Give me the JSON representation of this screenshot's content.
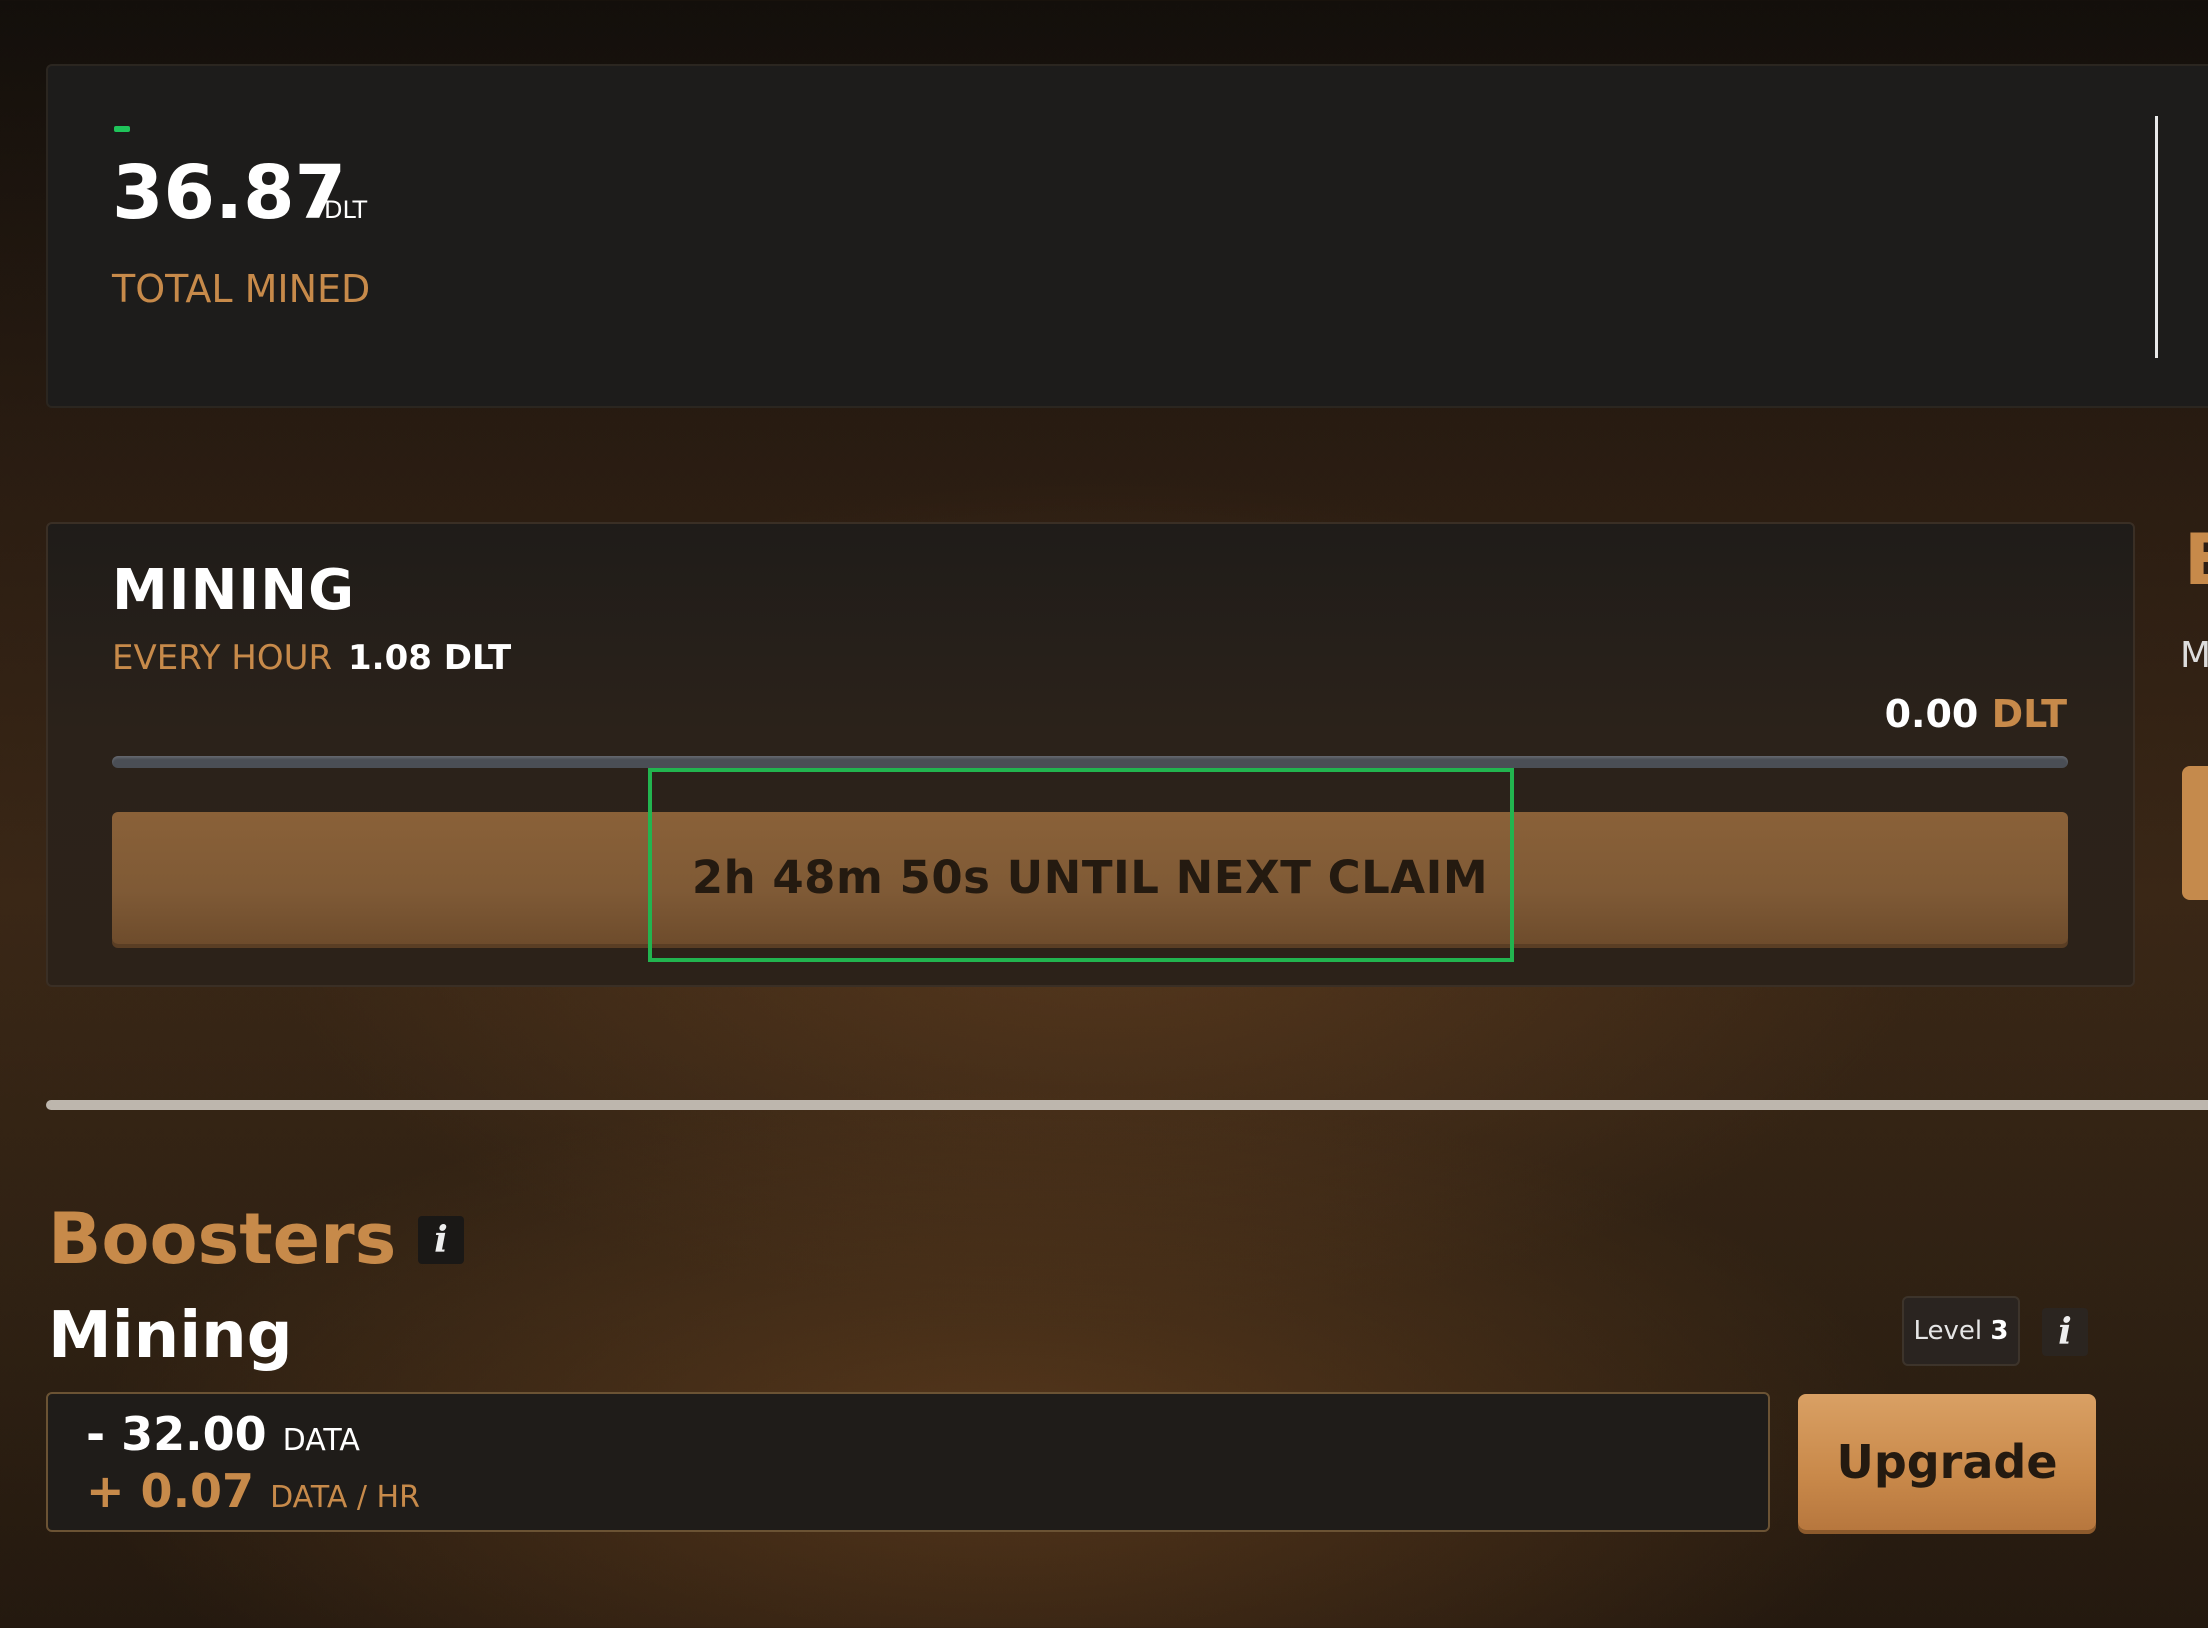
{
  "total": {
    "value": "36.87",
    "unit": "DLT",
    "label": "TOTAL MINED"
  },
  "mining": {
    "title": "MINING",
    "rate_label": "EVERY HOUR",
    "rate_value": "1.08 DLT",
    "progress_amount": "0.00",
    "progress_unit": "DLT",
    "progress_fraction": 0,
    "claim_label": "2h 48m 50s UNTIL NEXT CLAIM"
  },
  "right_edge": {
    "letter_top": "E",
    "letter_sub": "M"
  },
  "boosters": {
    "title": "Boosters",
    "info_icon": "i",
    "mining": {
      "title": "Mining",
      "level_label": "Level",
      "level_value": "3",
      "info_icon": "i",
      "cost_value": "- 32.00",
      "cost_unit": "DATA",
      "gain_value": "+ 0.07",
      "gain_unit": "DATA / HR",
      "upgrade_label": "Upgrade"
    }
  },
  "colors": {
    "accent": "#c78a4a",
    "highlight": "#22b44f",
    "positive": "#1fc35a"
  }
}
